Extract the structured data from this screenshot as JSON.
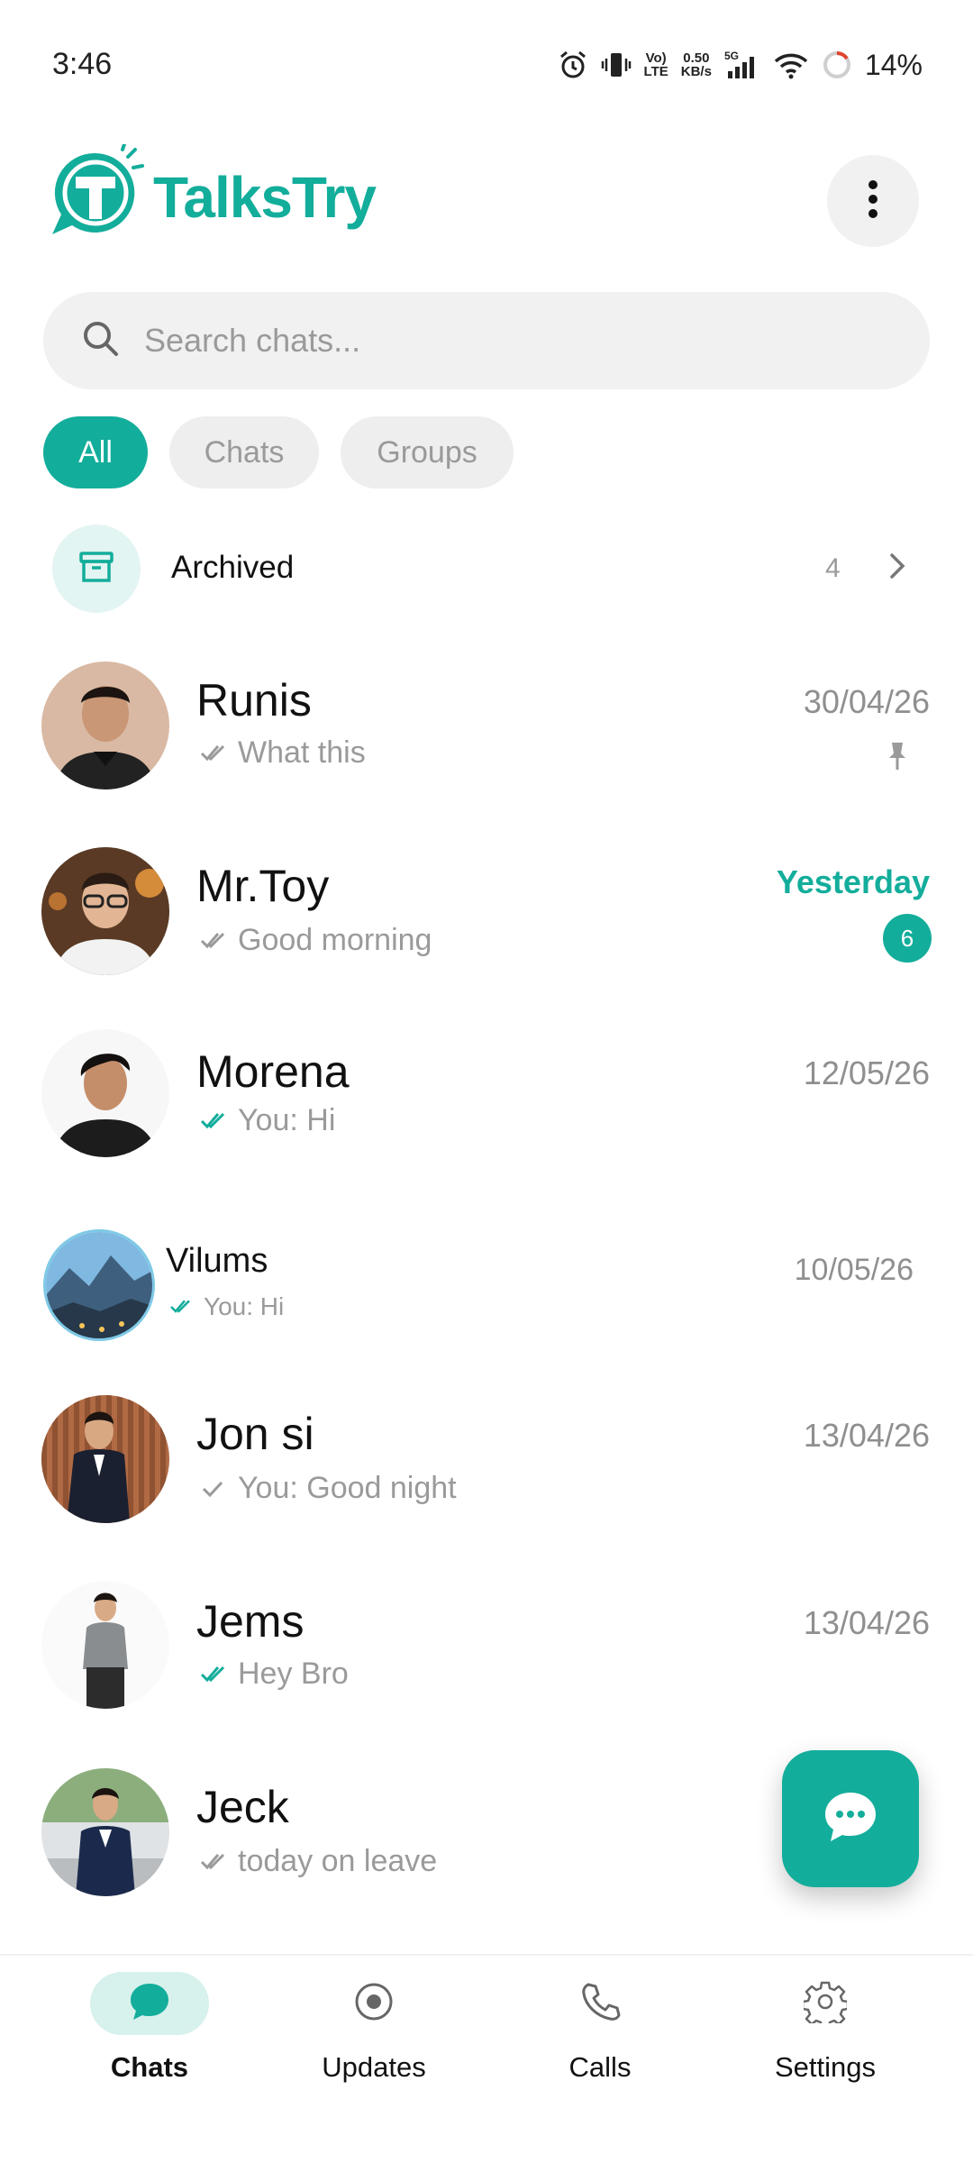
{
  "status_bar": {
    "time": "3:46",
    "network_top": "Vo)",
    "network_bottom": "LTE",
    "speed_top": "0.50",
    "speed_bottom": "KB/s",
    "gen": "5G",
    "battery": "14%"
  },
  "app": {
    "brand": "TalksTry",
    "brand_color": "#13ad9b"
  },
  "search": {
    "placeholder": "Search chats..."
  },
  "filters": [
    {
      "label": "All",
      "active": true
    },
    {
      "label": "Chats",
      "active": false
    },
    {
      "label": "Groups",
      "active": false
    }
  ],
  "archived": {
    "label": "Archived",
    "count": "4"
  },
  "chats": [
    {
      "name": "Runis",
      "preview": "What this",
      "date": "30/04/26",
      "tick": "double-gray",
      "pinned": true
    },
    {
      "name": "Mr.Toy",
      "preview": "Good morning",
      "date": "Yesterday",
      "tick": "double-gray",
      "unread": "6"
    },
    {
      "name": "Morena",
      "preview": "You: Hi",
      "date": "12/05/26",
      "tick": "double-teal"
    },
    {
      "name": "Vilums",
      "preview": "You: Hi",
      "date": "10/05/26",
      "tick": "double-teal"
    },
    {
      "name": "Jon si",
      "preview": "You: Good night",
      "date": "13/04/26",
      "tick": "single-gray"
    },
    {
      "name": "Jems",
      "preview": "Hey Bro",
      "date": "13/04/26",
      "tick": "double-teal"
    },
    {
      "name": "Jeck",
      "preview": "today on leave",
      "date": "",
      "tick": "double-gray"
    }
  ],
  "bottom_nav": [
    {
      "label": "Chats",
      "icon": "chat-bubble-icon",
      "active": true
    },
    {
      "label": "Updates",
      "icon": "status-icon",
      "active": false
    },
    {
      "label": "Calls",
      "icon": "phone-icon",
      "active": false
    },
    {
      "label": "Settings",
      "icon": "gear-icon",
      "active": false
    }
  ]
}
